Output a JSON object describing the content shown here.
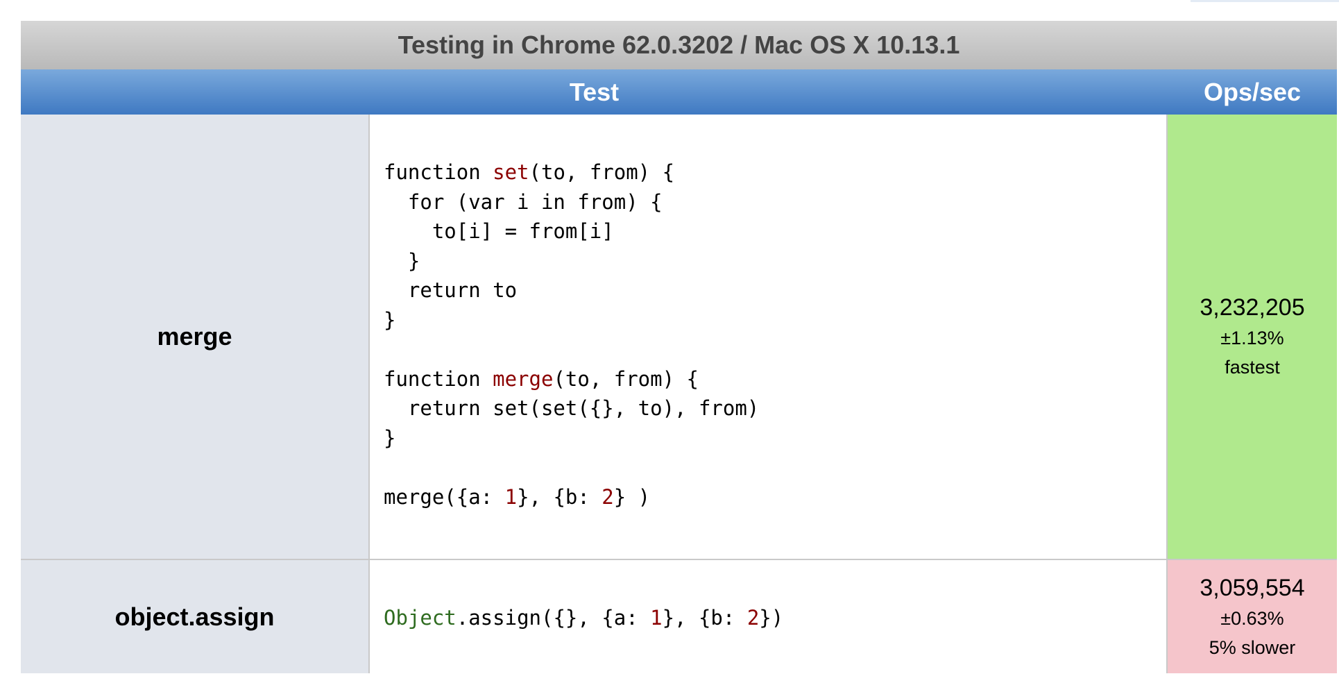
{
  "caption": "Testing in Chrome 62.0.3202 / Mac OS X 10.13.1",
  "headers": {
    "test": "Test",
    "ops": "Ops/sec"
  },
  "rows": [
    {
      "name": "merge",
      "code": {
        "l1_a": "function ",
        "l1_fn": "set",
        "l1_b": "(to, from) {",
        "l2": "  for (var i in from) {",
        "l3": "    to[i] = from[i]",
        "l4": "  }",
        "l5": "  return to",
        "l6": "}",
        "l7": "",
        "l8_a": "function ",
        "l8_fn": "merge",
        "l8_b": "(to, from) {",
        "l9": "  return set(set({}, to), from)",
        "l10": "}",
        "l11": "",
        "l12_a": "merge({a: ",
        "l12_n1": "1",
        "l12_b": "}, {b: ",
        "l12_n2": "2",
        "l12_c": "} )"
      },
      "ops": "3,232,205",
      "error": "±1.13%",
      "rank": "fastest",
      "status_color": "#b0e98d"
    },
    {
      "name": "object.assign",
      "code": {
        "builtin": "Object",
        "a": ".assign({}, {a: ",
        "n1": "1",
        "b": "}, {b: ",
        "n2": "2",
        "c": "})"
      },
      "ops": "3,059,554",
      "error": "±0.63%",
      "rank": "5% slower",
      "status_color": "#f5c5cb"
    }
  ]
}
